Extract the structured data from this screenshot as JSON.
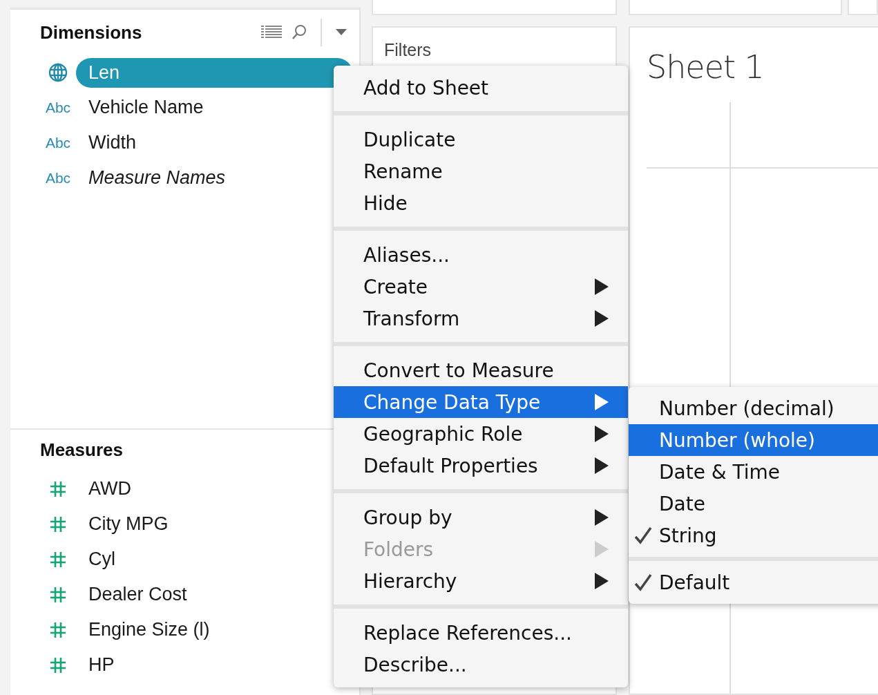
{
  "dimensions": {
    "title": "Dimensions",
    "items": [
      {
        "kind": "geo",
        "label": "Len",
        "selected": true,
        "italic": false
      },
      {
        "kind": "string",
        "type_label": "Abc",
        "label": "Vehicle Name",
        "selected": false,
        "italic": false
      },
      {
        "kind": "string",
        "type_label": "Abc",
        "label": "Width",
        "selected": false,
        "italic": false
      },
      {
        "kind": "string",
        "type_label": "Abc",
        "label": "Measure Names",
        "selected": false,
        "italic": true
      }
    ]
  },
  "measures": {
    "title": "Measures",
    "items": [
      {
        "kind": "number",
        "label": "AWD"
      },
      {
        "kind": "number",
        "label": "City MPG"
      },
      {
        "kind": "number",
        "label": "Cyl"
      },
      {
        "kind": "number",
        "label": "Dealer Cost"
      },
      {
        "kind": "number",
        "label": "Engine Size (l)"
      },
      {
        "kind": "number",
        "label": "HP"
      }
    ]
  },
  "filters": {
    "title": "Filters"
  },
  "sheet": {
    "title": "Sheet 1"
  },
  "context_menu": {
    "sections": [
      [
        {
          "label": "Add to Sheet",
          "submenu": false,
          "disabled": false,
          "selected": false
        }
      ],
      [
        {
          "label": "Duplicate",
          "submenu": false,
          "disabled": false,
          "selected": false
        },
        {
          "label": "Rename",
          "submenu": false,
          "disabled": false,
          "selected": false
        },
        {
          "label": "Hide",
          "submenu": false,
          "disabled": false,
          "selected": false
        }
      ],
      [
        {
          "label": "Aliases...",
          "submenu": false,
          "disabled": false,
          "selected": false
        },
        {
          "label": "Create",
          "submenu": true,
          "disabled": false,
          "selected": false
        },
        {
          "label": "Transform",
          "submenu": true,
          "disabled": false,
          "selected": false
        }
      ],
      [
        {
          "label": "Convert to Measure",
          "submenu": false,
          "disabled": false,
          "selected": false
        },
        {
          "label": "Change Data Type",
          "submenu": true,
          "disabled": false,
          "selected": true
        },
        {
          "label": "Geographic Role",
          "submenu": true,
          "disabled": false,
          "selected": false
        },
        {
          "label": "Default Properties",
          "submenu": true,
          "disabled": false,
          "selected": false
        }
      ],
      [
        {
          "label": "Group by",
          "submenu": true,
          "disabled": false,
          "selected": false
        },
        {
          "label": "Folders",
          "submenu": true,
          "disabled": true,
          "selected": false
        },
        {
          "label": "Hierarchy",
          "submenu": true,
          "disabled": false,
          "selected": false
        }
      ],
      [
        {
          "label": "Replace References...",
          "submenu": false,
          "disabled": false,
          "selected": false
        },
        {
          "label": "Describe...",
          "submenu": false,
          "disabled": false,
          "selected": false
        }
      ]
    ]
  },
  "submenu": {
    "sections": [
      [
        {
          "label": "Number (decimal)",
          "checked": false,
          "selected": false
        },
        {
          "label": "Number (whole)",
          "checked": false,
          "selected": true
        },
        {
          "label": "Date & Time",
          "checked": false,
          "selected": false
        },
        {
          "label": "Date",
          "checked": false,
          "selected": false
        },
        {
          "label": "String",
          "checked": true,
          "selected": false
        }
      ],
      [
        {
          "label": "Default",
          "checked": true,
          "selected": false
        }
      ]
    ]
  }
}
